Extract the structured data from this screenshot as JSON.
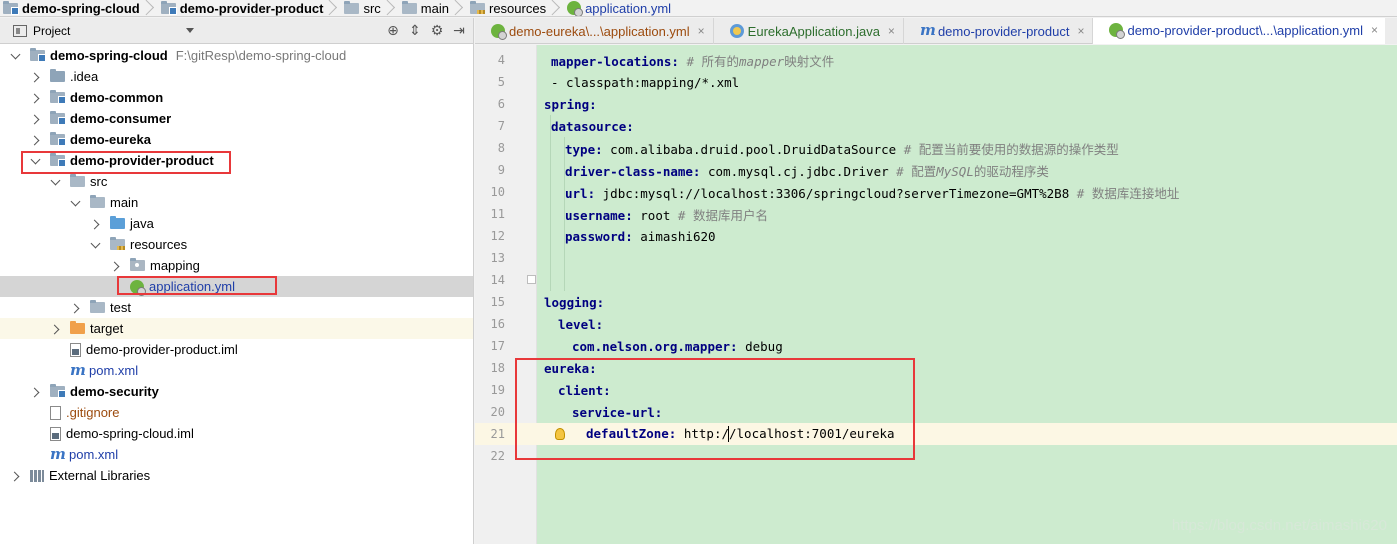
{
  "breadcrumb": [
    {
      "label": "demo-spring-cloud",
      "bold": true,
      "icon": "module-folder-icon"
    },
    {
      "label": "demo-provider-product",
      "bold": true,
      "icon": "module-folder-icon"
    },
    {
      "label": "src",
      "icon": "folder-icon"
    },
    {
      "label": "main",
      "icon": "folder-icon"
    },
    {
      "label": "resources",
      "icon": "resources-folder-icon"
    },
    {
      "label": "application.yml",
      "icon": "spring-yml-icon"
    }
  ],
  "project_panel": {
    "title": "Project",
    "tools": [
      "target-icon",
      "collapse-icon",
      "gear-icon",
      "hide-icon"
    ],
    "tree": [
      {
        "label": "demo-spring-cloud",
        "path": "F:\\gitResp\\demo-spring-cloud",
        "bold": true
      },
      {
        "label": ".idea"
      },
      {
        "label": "demo-common"
      },
      {
        "label": "demo-consumer"
      },
      {
        "label": "demo-eureka"
      },
      {
        "label": "demo-provider-product"
      },
      {
        "label": "src"
      },
      {
        "label": "main"
      },
      {
        "label": "java"
      },
      {
        "label": "resources"
      },
      {
        "label": "mapping"
      },
      {
        "label": "application.yml"
      },
      {
        "label": "test"
      },
      {
        "label": "target"
      },
      {
        "label": "demo-provider-product.iml"
      },
      {
        "label": "pom.xml"
      },
      {
        "label": "demo-security"
      },
      {
        "label": ".gitignore"
      },
      {
        "label": "demo-spring-cloud.iml"
      },
      {
        "label": "pom.xml"
      },
      {
        "label": "External Libraries"
      }
    ]
  },
  "tabs": [
    {
      "label": "demo-eureka\\...\\application.yml",
      "close": "×"
    },
    {
      "label": "EurekaApplication.java",
      "close": "×"
    },
    {
      "label": "demo-provider-product",
      "close": "×"
    },
    {
      "label": "demo-provider-product\\...\\application.yml",
      "close": "×"
    }
  ],
  "editor": {
    "lines": [
      {
        "n": "4"
      },
      {
        "n": "5"
      },
      {
        "n": "6"
      },
      {
        "n": "7"
      },
      {
        "n": "8"
      },
      {
        "n": "9"
      },
      {
        "n": "10"
      },
      {
        "n": "11"
      },
      {
        "n": "12"
      },
      {
        "n": "13"
      },
      {
        "n": "14"
      },
      {
        "n": "15"
      },
      {
        "n": "16"
      },
      {
        "n": "17"
      },
      {
        "n": "18"
      },
      {
        "n": "19"
      },
      {
        "n": "20"
      },
      {
        "n": "21"
      },
      {
        "n": "22"
      }
    ],
    "code": {
      "l4_key": "mapper-locations:",
      "l4_comment_a": "# 所有的",
      "l4_comment_b": "mapper",
      "l4_comment_c": "映射文件",
      "l5": "- classpath:mapping/*.xml",
      "l6_key": "spring:",
      "l7_key": "datasource:",
      "l8_key": "type:",
      "l8_val": "com.alibaba.druid.pool.DruidDataSource",
      "l8_comment": "# 配置当前要使用的数据源的操作类型",
      "l9_key": "driver-class-name:",
      "l9_val": "com.mysql.cj.jdbc.Driver",
      "l9_comment_a": "# 配置",
      "l9_comment_b": "MySQL",
      "l9_comment_c": "的驱动程序类",
      "l10_key": "url:",
      "l10_val": "jdbc:mysql://localhost:3306/springcloud?serverTimezone=GMT%2B8",
      "l10_comment": "# 数据库连接地址",
      "l11_key": "username:",
      "l11_val": "root",
      "l11_comment": "# 数据库用户名",
      "l12_key": "password:",
      "l12_val": "aimashi620",
      "l15_key": "logging:",
      "l16_key": "level:",
      "l17_key": "com.nelson.org.mapper:",
      "l17_val": "debug",
      "l18_key": "eureka:",
      "l19_key": "client:",
      "l20_key": "service-url:",
      "l21_key": "defaultZone:",
      "l21_val_a": "http:/",
      "l21_val_b": "/localhost:7001/eureka"
    }
  },
  "watermark": "https://blog.csdn.net/aimashi620"
}
